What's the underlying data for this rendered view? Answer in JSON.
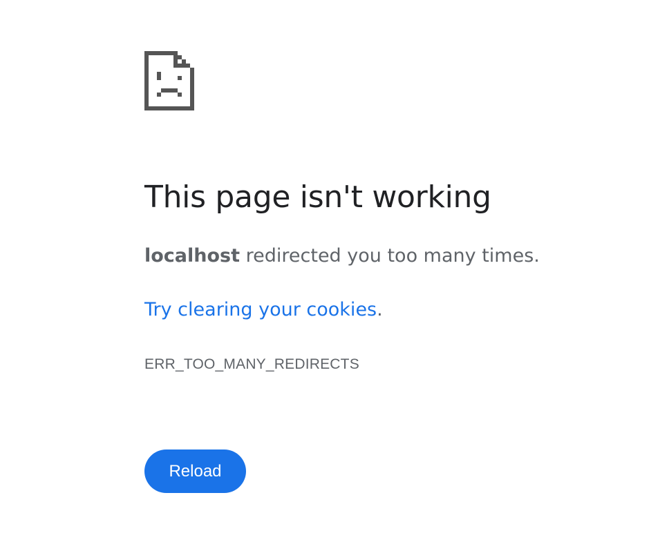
{
  "icon": {
    "name": "sad-page-icon",
    "color": "#555555"
  },
  "main": {
    "title": "This page isn't working",
    "summary_host": "localhost",
    "summary_rest": " redirected you too many times.",
    "suggestion_link": "Try clearing your cookies",
    "suggestion_end": ".",
    "error_code": "ERR_TOO_MANY_REDIRECTS"
  },
  "buttons": {
    "reload_label": "Reload"
  },
  "colors": {
    "accent": "#1a73e8",
    "heading": "#202124",
    "body_text": "#5f6368",
    "background": "#ffffff"
  }
}
